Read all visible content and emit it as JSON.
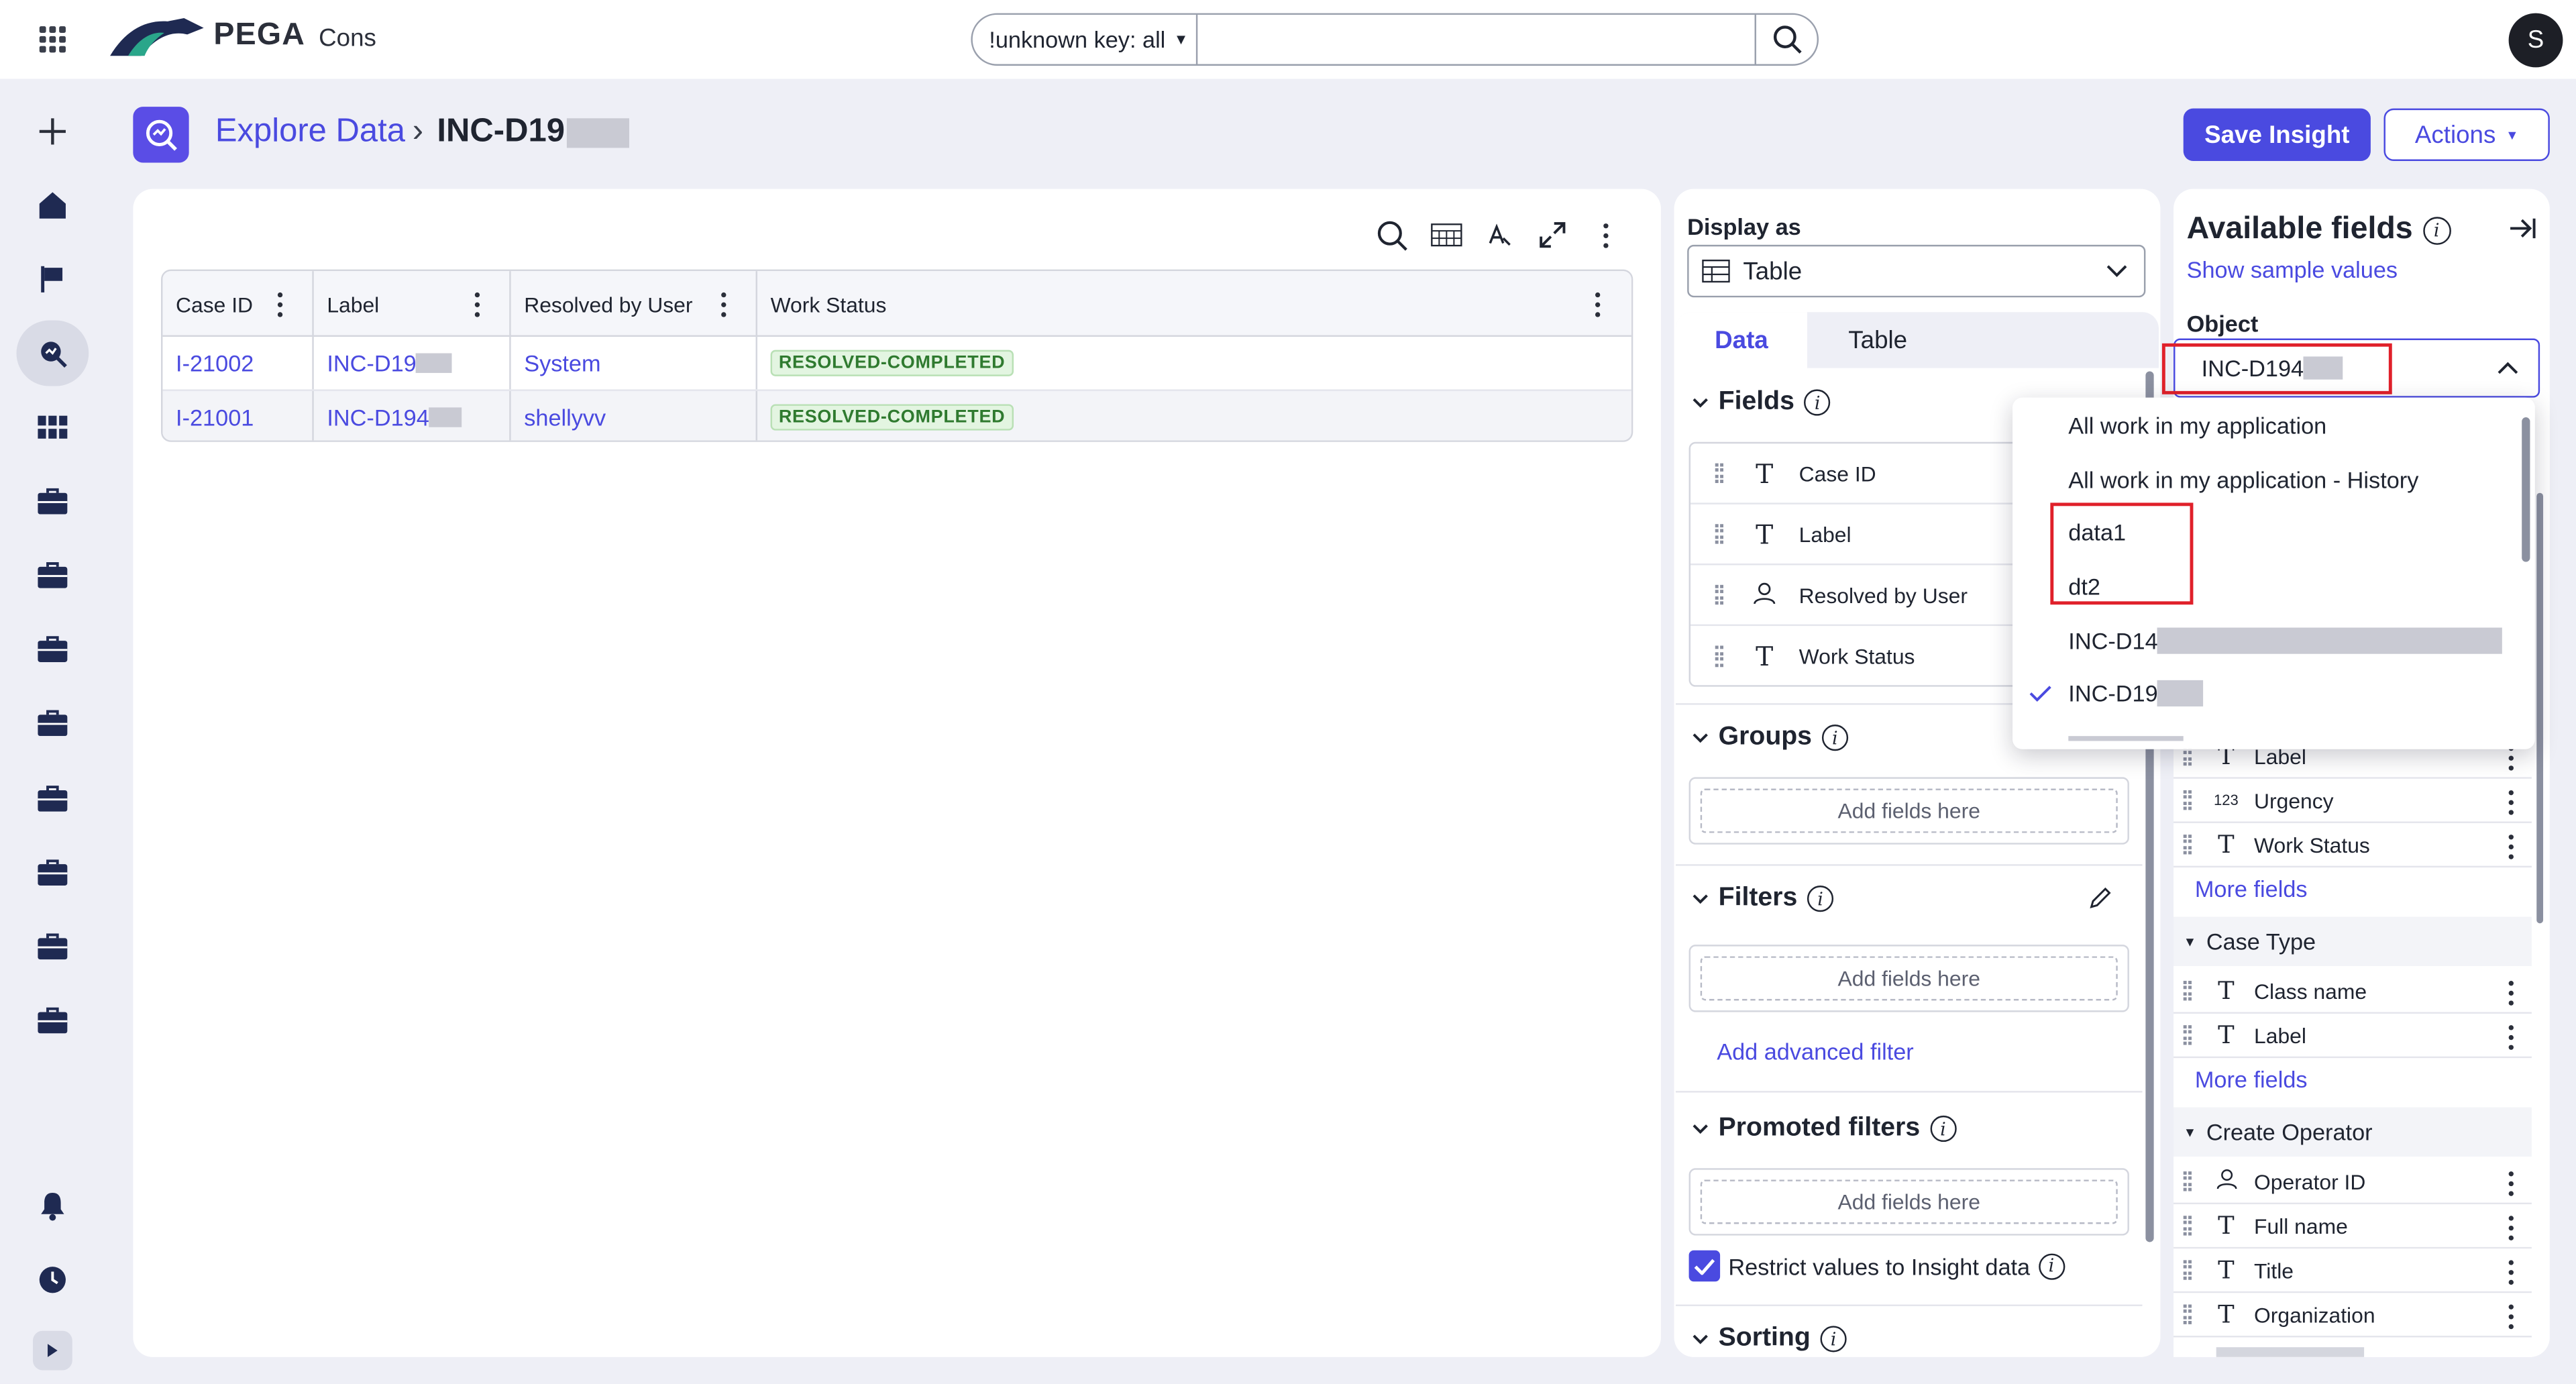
{
  "colors": {
    "accent": "#4a4ae0",
    "success_bg": "#e3f5e1",
    "success_text": "#2f7a2f",
    "highlight_box": "#e0202a"
  },
  "topbar": {
    "brand": "PEGA",
    "app_name": "Cons",
    "search_scope": "!unknown key: all",
    "search_value": "",
    "avatar_initial": "S"
  },
  "nav": {
    "icons": [
      "plus-icon",
      "home-icon",
      "flag-icon",
      "explore-data-icon",
      "apps-grid-icon",
      "case-icon",
      "case-icon",
      "case-icon",
      "case-icon",
      "case-icon",
      "case-icon",
      "case-icon",
      "case-icon",
      "bell-icon",
      "clock-icon",
      "expand-icon"
    ]
  },
  "header": {
    "breadcrumb_link": "Explore Data",
    "breadcrumb_sep": "›",
    "current": "INC-D19",
    "save_label": "Save Insight",
    "actions_label": "Actions"
  },
  "grid": {
    "columns": [
      "Case ID",
      "Label",
      "Resolved by User",
      "Work Status"
    ],
    "rows": [
      {
        "case_id": "I-21002",
        "label": "INC-D19",
        "resolved_by": "System",
        "status": "RESOLVED-COMPLETED"
      },
      {
        "case_id": "I-21001",
        "label": "INC-D194",
        "resolved_by": "shellyvv",
        "status": "RESOLVED-COMPLETED"
      }
    ]
  },
  "display": {
    "display_as_label": "Display as",
    "display_as_value": "Table",
    "tabs": [
      "Data",
      "Table"
    ],
    "fields_title": "Fields",
    "fields": [
      {
        "type": "T",
        "label": "Case ID"
      },
      {
        "type": "T",
        "label": "Label"
      },
      {
        "type": "user",
        "label": "Resolved by User"
      },
      {
        "type": "T",
        "label": "Work Status"
      }
    ],
    "groups_title": "Groups",
    "filters_title": "Filters",
    "promoted_title": "Promoted filters",
    "add_fields_here": "Add fields here",
    "add_advanced_filter": "Add advanced filter",
    "restrict_label": "Restrict values to Insight data",
    "restrict_checked": true,
    "sorting_title": "Sorting"
  },
  "available": {
    "title": "Available fields",
    "show_sample": "Show sample values",
    "object_label": "Object",
    "object_value": "INC-D194",
    "fields_top": [
      {
        "type": "T",
        "label": "Label"
      },
      {
        "type": "123",
        "label": "Urgency"
      },
      {
        "type": "T",
        "label": "Work Status"
      }
    ],
    "more_fields": "More fields",
    "groups": [
      {
        "name": "Case Type",
        "fields": [
          {
            "type": "T",
            "label": "Class name"
          },
          {
            "type": "T",
            "label": "Label"
          }
        ]
      },
      {
        "name": "Create Operator",
        "fields": [
          {
            "type": "user",
            "label": "Operator ID"
          },
          {
            "type": "T",
            "label": "Full name"
          },
          {
            "type": "T",
            "label": "Title"
          },
          {
            "type": "T",
            "label": "Organization"
          }
        ]
      }
    ]
  },
  "dropdown": {
    "items": [
      {
        "label": "All work in my application",
        "selected": false
      },
      {
        "label": "All work in my application - History",
        "selected": false
      },
      {
        "label": "data1",
        "selected": false
      },
      {
        "label": "dt2",
        "selected": false
      },
      {
        "label": "INC-D14",
        "selected": false
      },
      {
        "label": "INC-D19",
        "selected": true
      }
    ]
  }
}
